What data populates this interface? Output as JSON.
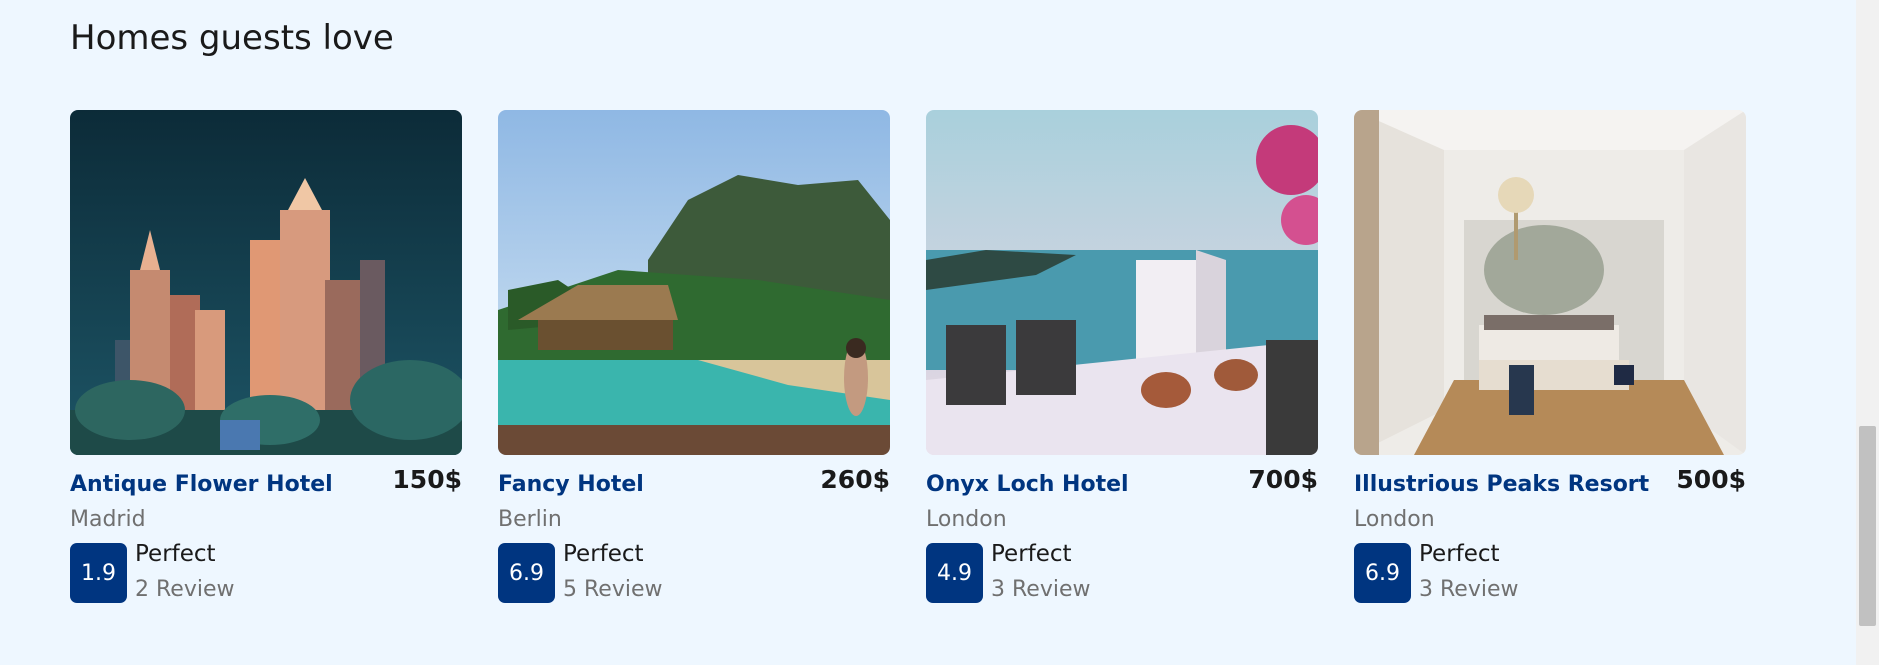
{
  "section": {
    "title": "Homes guests love"
  },
  "cards": [
    {
      "name": "Antique Flower Hotel",
      "price": "150$",
      "city": "Madrid",
      "score": "1.9",
      "rating_word": "Perfect",
      "reviews": "2 Review",
      "image": "city-skyline-night"
    },
    {
      "name": "Fancy Hotel",
      "price": "260$",
      "city": "Berlin",
      "score": "6.9",
      "rating_word": "Perfect",
      "reviews": "5 Review",
      "image": "tropical-pool"
    },
    {
      "name": "Onyx Loch Hotel",
      "price": "700$",
      "city": "London",
      "score": "4.9",
      "rating_word": "Perfect",
      "reviews": "3 Review",
      "image": "sea-view-terrace"
    },
    {
      "name": "Illustrious Peaks Resort",
      "price": "500$",
      "city": "London",
      "score": "6.9",
      "rating_word": "Perfect",
      "reviews": "3 Review",
      "image": "luxury-bedroom"
    }
  ],
  "colors": {
    "brand": "#003580",
    "background": "#eef7ff",
    "muted": "#707070"
  }
}
